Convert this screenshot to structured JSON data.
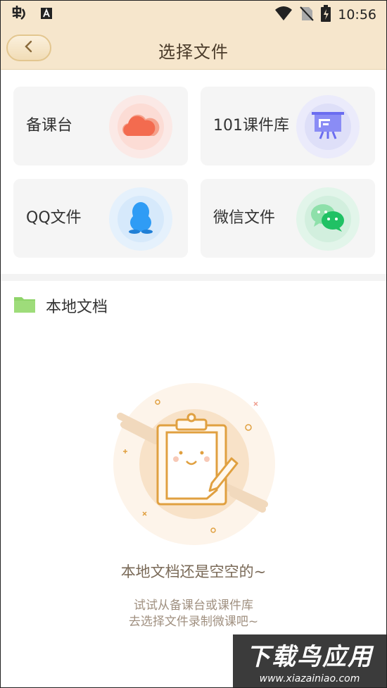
{
  "status_bar": {
    "time": "10:56",
    "icons": [
      "app-notification-icon",
      "font-a-icon",
      "wifi-icon",
      "no-sim-icon",
      "battery-charging-icon"
    ]
  },
  "header": {
    "title": "选择文件",
    "back_icon": "chevron-left-icon"
  },
  "sources": [
    {
      "label": "备课台",
      "icon": "cloud-icon",
      "color": "#f36b4f"
    },
    {
      "label": "101课件库",
      "icon": "presentation-board-icon",
      "color": "#6a6cf0"
    },
    {
      "label": "QQ文件",
      "icon": "qq-penguin-icon",
      "color": "#2f9cf5"
    },
    {
      "label": "微信文件",
      "icon": "wechat-icon",
      "color": "#20c164"
    }
  ],
  "local": {
    "label": "本地文档",
    "icon": "folder-icon",
    "folder_color": "#8fd46a"
  },
  "empty_state": {
    "title": "本地文档还是空空的~",
    "hint_line1": "试试从备课台或课件库",
    "hint_line2": "去选择文件录制微课吧~",
    "illustration": "clipboard-icon"
  },
  "watermark": {
    "main": "下载鸟应用",
    "url": "www.xiazainiao.com"
  },
  "colors": {
    "header_bg": "#f6e6cc",
    "card_bg": "#f5f5f5",
    "accent": "#e0a040"
  }
}
